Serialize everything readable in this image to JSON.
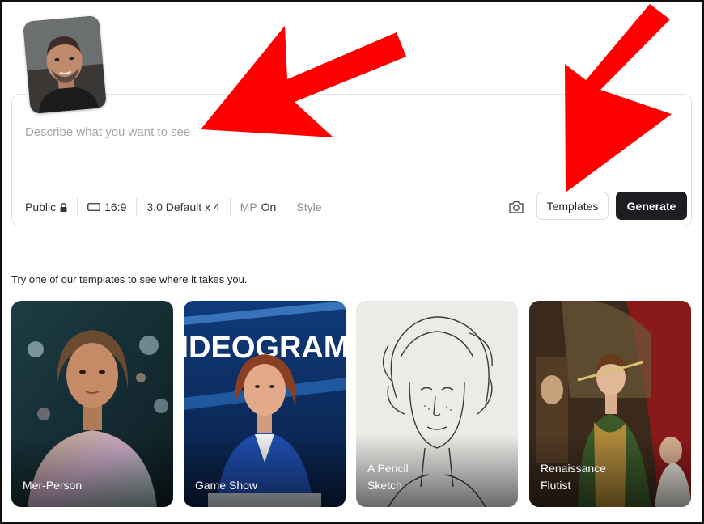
{
  "prompt": {
    "placeholder": "Describe what you want to see",
    "value": ""
  },
  "toolbar": {
    "visibility_label": "Public",
    "visibility_icon": "lock-icon",
    "aspect_ratio": "16:9",
    "aspect_icon": "rectangle-icon",
    "model_label": "3.0 Default x 4",
    "magic_prompt_prefix": "MP",
    "magic_prompt_value": "On",
    "style_label": "Style",
    "camera_icon": "camera-icon",
    "templates_label": "Templates",
    "generate_label": "Generate"
  },
  "templates_hint": "Try one of our templates to see where it takes you.",
  "templates": [
    {
      "label": "Mer-Person"
    },
    {
      "label": "Game Show",
      "image_text": "IDEOGRAM"
    },
    {
      "label": "A Pencil\nSketch"
    },
    {
      "label": "Renaissance\nFlutist"
    }
  ],
  "annotations": {
    "arrow_color": "#ff0000",
    "arrow_count": 2
  },
  "colors": {
    "generate_bg": "#1e1e22",
    "card_border": "#e3e3e6"
  }
}
